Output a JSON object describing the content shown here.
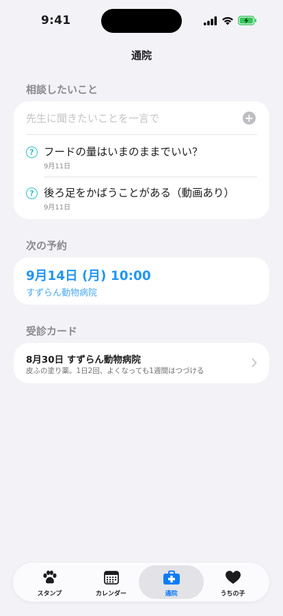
{
  "status_bar": {
    "time": "9:41"
  },
  "nav": {
    "title": "通院"
  },
  "consult": {
    "section_title": "相談したいこと",
    "input_placeholder": "先生に聞きたいことを一言で",
    "add_icon": "plus-circle-icon",
    "items": [
      {
        "icon": "question-circle-icon",
        "text": "フードの量はいまのままでいい？",
        "date": "9月11日"
      },
      {
        "icon": "question-circle-icon",
        "text": "後ろ足をかばうことがある（動画あり）",
        "date": "9月11日"
      }
    ]
  },
  "appointment": {
    "section_title": "次の予約",
    "datetime": "9月14日 (月) 10:00",
    "clinic": "すずらん動物病院"
  },
  "visit_cards": {
    "section_title": "受診カード",
    "items": [
      {
        "title": "8月30日  すずらん動物病院",
        "note": "皮ふの塗り薬。1日2回、よくなっても1週間はつづける"
      }
    ]
  },
  "tab_bar": {
    "tabs": [
      {
        "label": "スタンプ",
        "icon": "paw-icon",
        "active": false
      },
      {
        "label": "カレンダー",
        "icon": "calendar-icon",
        "active": false
      },
      {
        "label": "通院",
        "icon": "medical-bag-icon",
        "active": true
      },
      {
        "label": "うちの子",
        "icon": "heart-icon",
        "active": false
      }
    ]
  },
  "colors": {
    "accent": "#0a7cf6",
    "appointment_blue": "#2196f3",
    "question_teal": "#2cc2c2",
    "background": "#f2f2f7"
  }
}
